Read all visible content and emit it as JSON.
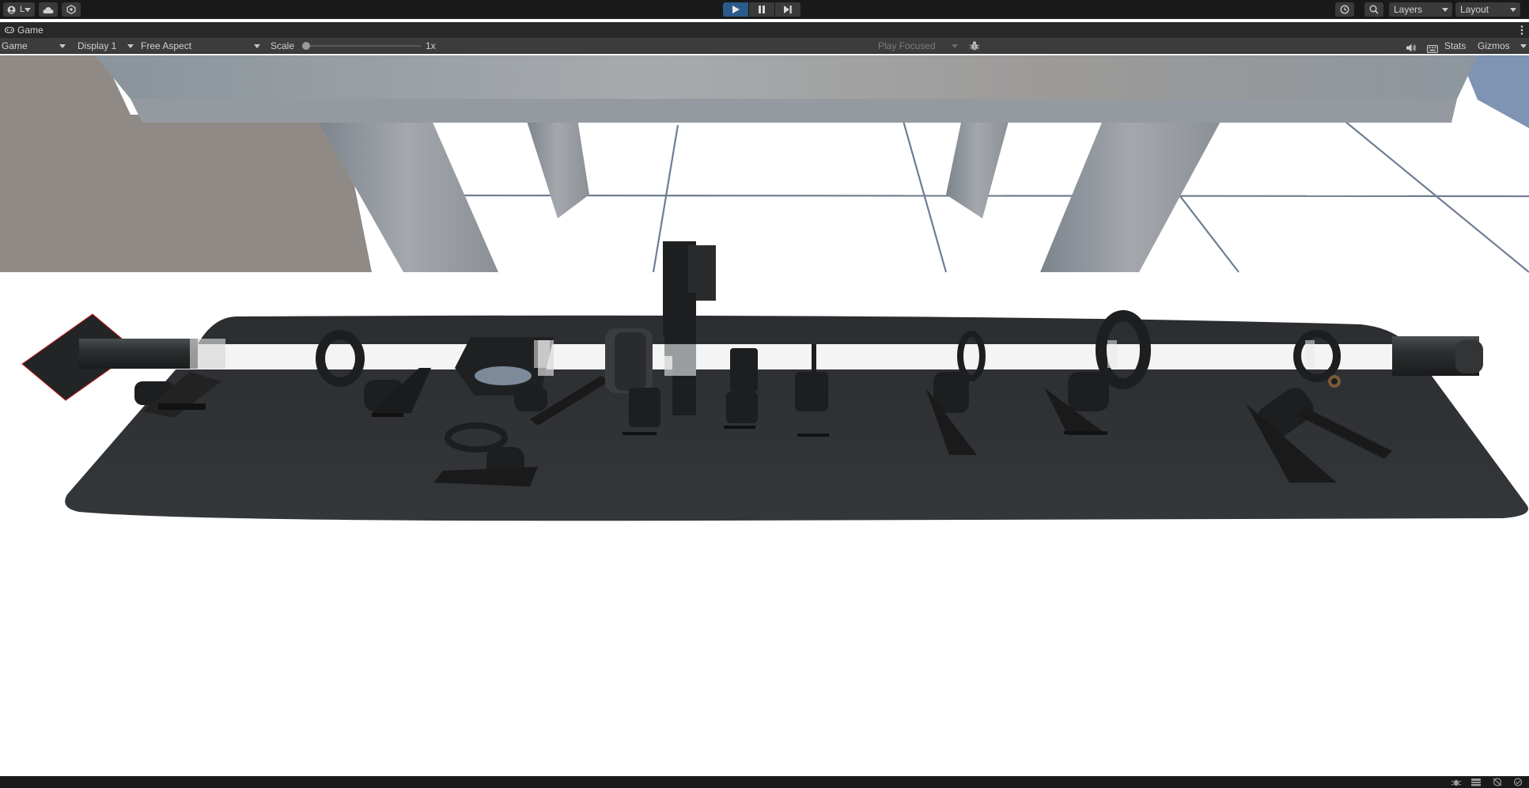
{
  "toolbar": {
    "account_label": "L",
    "account_icon": "account-icon",
    "cloud_icon": "cloud-icon",
    "collab_icon": "collab-icon",
    "play_icon": "play-icon",
    "pause_icon": "pause-icon",
    "step_icon": "step-icon",
    "history_icon": "history-icon",
    "search_icon": "search-icon",
    "layers_label": "Layers",
    "layout_label": "Layout"
  },
  "tab": {
    "icon": "gamepad-icon",
    "label": "Game"
  },
  "gamebar": {
    "mode_label": "Game",
    "display_label": "Display 1",
    "aspect_label": "Free Aspect",
    "scale_label": "Scale",
    "scale_value": "1x",
    "scale_fraction": 0.0,
    "play_focus_label": "Play Focused",
    "bug_icon": "bug-icon",
    "audio_icon": "speaker-icon",
    "grid_icon": "keyboard-icon",
    "stats_label": "Stats",
    "gizmos_label": "Gizmos"
  },
  "colors": {
    "toolbar_bg": "#191919",
    "bar_bg": "#3c3c3c",
    "play_active": "#2a5b8a",
    "breadboard": "#2f3133",
    "component": "#1f2022",
    "sky": "#ffffff"
  },
  "statusbar": {
    "icons": [
      "debug-icon",
      "bake-icon",
      "network-icon",
      "status-check-icon"
    ]
  }
}
